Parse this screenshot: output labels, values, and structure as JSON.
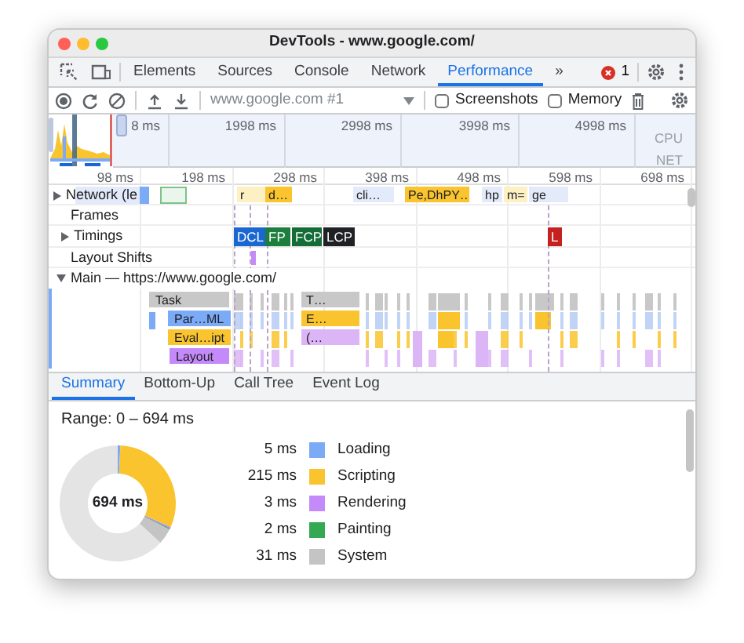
{
  "window": {
    "title": "DevTools - www.google.com/"
  },
  "panel_tabs": [
    {
      "label": "Elements",
      "selected": false
    },
    {
      "label": "Sources",
      "selected": false
    },
    {
      "label": "Console",
      "selected": false
    },
    {
      "label": "Network",
      "selected": false
    },
    {
      "label": "Performance",
      "selected": true
    }
  ],
  "more_tabs": "»",
  "errors": {
    "count": "1"
  },
  "toolbar": {
    "recording": "www.google.com #1",
    "options": [
      {
        "label": "Screenshots",
        "checked": false
      },
      {
        "label": "Memory",
        "checked": false
      }
    ]
  },
  "overview": {
    "ticks": [
      "8 ms",
      "1998 ms",
      "2998 ms",
      "3998 ms",
      "4998 ms"
    ],
    "lanes": [
      "CPU",
      "NET"
    ]
  },
  "ruler": [
    "98 ms",
    "198 ms",
    "298 ms",
    "398 ms",
    "498 ms",
    "598 ms",
    "698 ms"
  ],
  "tracks": [
    {
      "label": "Network (le",
      "kind": "group",
      "expanded": false
    },
    {
      "label": "Frames",
      "kind": "plain"
    },
    {
      "label": "Timings",
      "kind": "group",
      "expanded": false
    },
    {
      "label": "Layout Shifts",
      "kind": "plain"
    },
    {
      "label": "Main — https://www.google.com/",
      "kind": "group",
      "expanded": true
    }
  ],
  "network_requests": [
    {
      "label": "r",
      "color": "#fdf0c2"
    },
    {
      "label": "d…",
      "color": "#f9c42e"
    },
    {
      "label": "cli…",
      "color": "#e3ebfa"
    },
    {
      "label": "Pe,DhPY…",
      "color": "#f9c42e"
    },
    {
      "label": "hp",
      "color": "#e3ebfa"
    },
    {
      "label": "m=",
      "color": "#fdf0c2"
    },
    {
      "label": "ge",
      "color": "#e3ebfa"
    }
  ],
  "timings": [
    {
      "label": "DCL",
      "color": "#1a67d2"
    },
    {
      "label": "FP",
      "color": "#1e7e3e"
    },
    {
      "label": "FCP",
      "color": "#146c36"
    },
    {
      "label": "LCP",
      "color": "#202124"
    },
    {
      "label": "L",
      "color": "#c5221f"
    }
  ],
  "main_events": [
    {
      "label": "Task",
      "color": "#c8c8c8"
    },
    {
      "label": "Par…ML",
      "color": "#7baaf7"
    },
    {
      "label": "Eval…ipt",
      "color": "#f9c42e"
    },
    {
      "label": "Layout",
      "color": "#c58af9"
    },
    {
      "label": "T…",
      "color": "#c8c8c8"
    },
    {
      "label": "E…",
      "color": "#f9c42e"
    },
    {
      "label": "(…",
      "color": "#dcb5f7"
    }
  ],
  "details_tabs": [
    {
      "label": "Summary",
      "selected": true
    },
    {
      "label": "Bottom-Up",
      "selected": false
    },
    {
      "label": "Call Tree",
      "selected": false
    },
    {
      "label": "Event Log",
      "selected": false
    }
  ],
  "summary": {
    "range": "Range: 0 – 694 ms",
    "total": "694 ms",
    "categories": [
      {
        "value": "5 ms",
        "label": "Loading",
        "color": "#7baaf7"
      },
      {
        "value": "215 ms",
        "label": "Scripting",
        "color": "#f9c42e"
      },
      {
        "value": "3 ms",
        "label": "Rendering",
        "color": "#c58af9"
      },
      {
        "value": "2 ms",
        "label": "Painting",
        "color": "#34a853"
      },
      {
        "value": "31 ms",
        "label": "System",
        "color": "#c4c4c4"
      }
    ]
  }
}
